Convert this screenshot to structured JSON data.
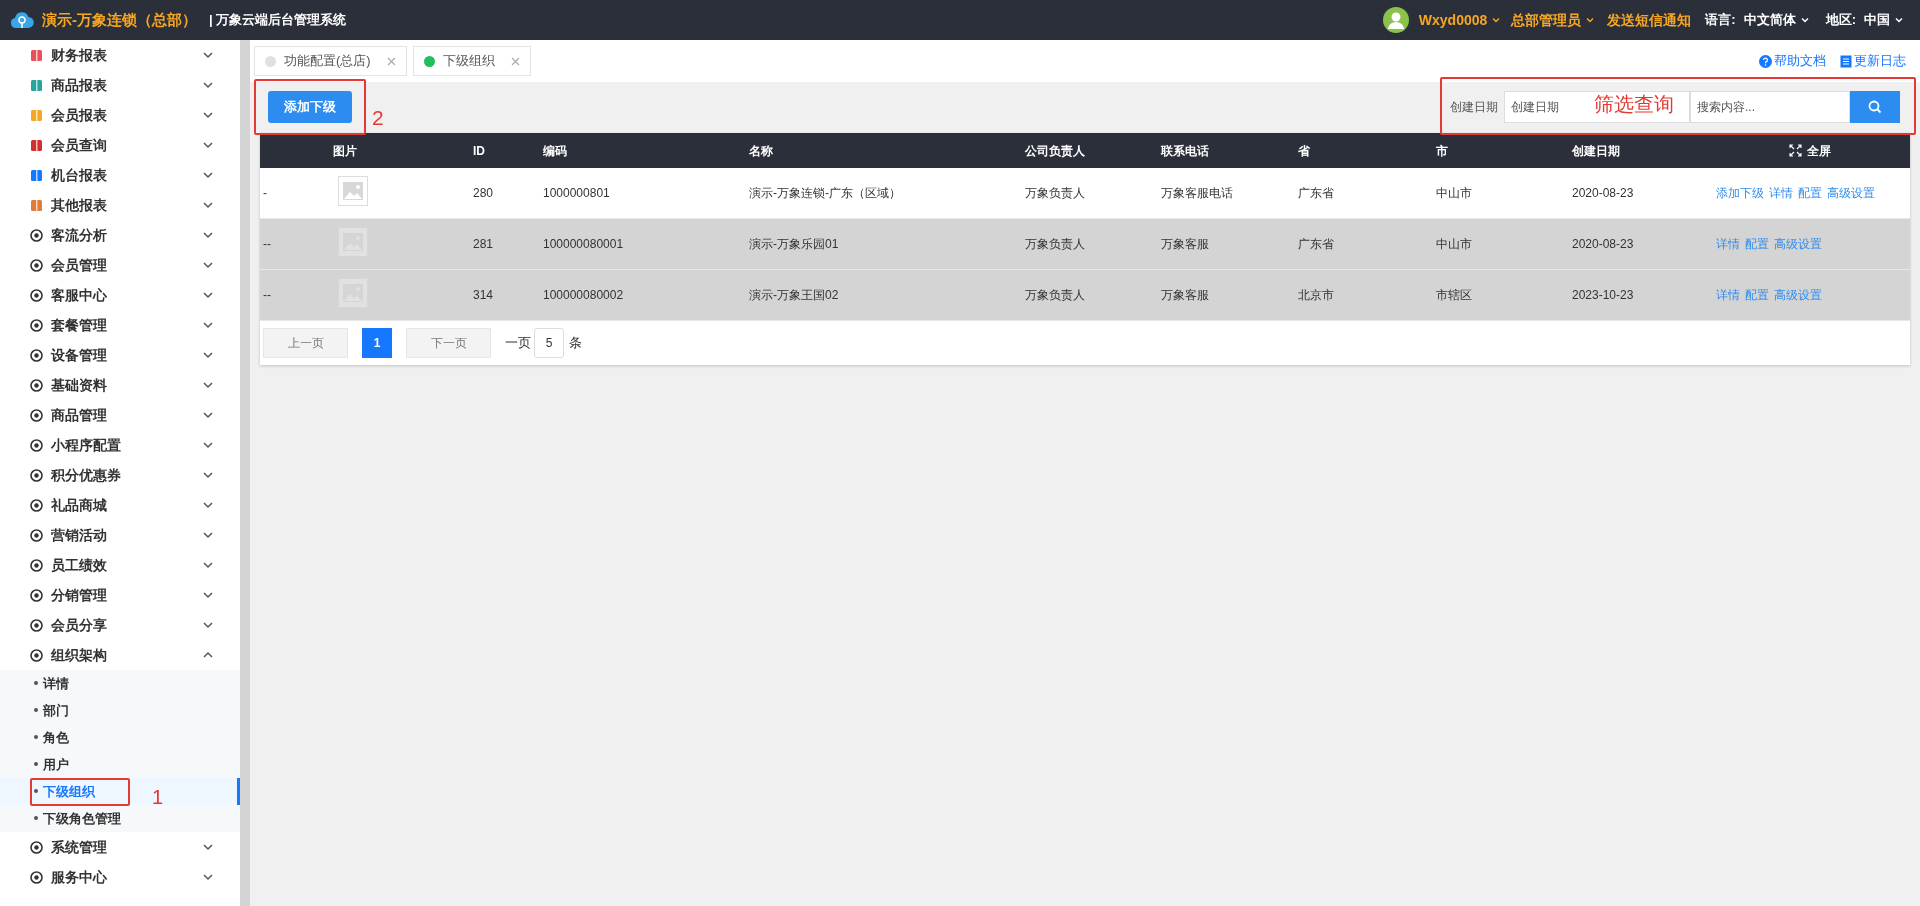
{
  "header": {
    "brand": "演示-万象连锁（总部）",
    "system": "| 万象云端后台管理系统",
    "user": "Wxyd0008",
    "role": "总部管理员",
    "sms": "发送短信通知",
    "language_label": "语言:",
    "language": "中文简体",
    "region_label": "地区:",
    "region": "中国"
  },
  "sidebar": {
    "items": [
      {
        "label": "财务报表",
        "expanded": false
      },
      {
        "label": "商品报表",
        "expanded": false
      },
      {
        "label": "会员报表",
        "expanded": false
      },
      {
        "label": "会员查询",
        "expanded": false
      },
      {
        "label": "机台报表",
        "expanded": false
      },
      {
        "label": "其他报表",
        "expanded": false
      },
      {
        "label": "客流分析",
        "expanded": false
      },
      {
        "label": "会员管理",
        "expanded": false
      },
      {
        "label": "客服中心",
        "expanded": false
      },
      {
        "label": "套餐管理",
        "expanded": false
      },
      {
        "label": "设备管理",
        "expanded": false
      },
      {
        "label": "基础资料",
        "expanded": false
      },
      {
        "label": "商品管理",
        "expanded": false
      },
      {
        "label": "小程序配置",
        "expanded": false
      },
      {
        "label": "积分优惠券",
        "expanded": false
      },
      {
        "label": "礼品商城",
        "expanded": false
      },
      {
        "label": "营销活动",
        "expanded": false
      },
      {
        "label": "员工绩效",
        "expanded": false
      },
      {
        "label": "分销管理",
        "expanded": false
      },
      {
        "label": "会员分享",
        "expanded": false
      },
      {
        "label": "组织架构",
        "expanded": true,
        "children": [
          {
            "label": "详情",
            "selected": false
          },
          {
            "label": "部门",
            "selected": false
          },
          {
            "label": "角色",
            "selected": false
          },
          {
            "label": "用户",
            "selected": false
          },
          {
            "label": "下级组织",
            "selected": true,
            "annotation": "1"
          },
          {
            "label": "下级角色管理",
            "selected": false
          }
        ]
      },
      {
        "label": "系统管理",
        "expanded": false
      },
      {
        "label": "服务中心",
        "expanded": false
      }
    ]
  },
  "tabs": [
    {
      "label": "功能配置(总店)",
      "selected": false
    },
    {
      "label": "下级组织",
      "selected": true
    }
  ],
  "help_links": [
    "帮助文档",
    "更新日志"
  ],
  "toolbar": {
    "add_button": "添加下级",
    "add_annotation": "2",
    "filter_label": "创建日期",
    "date_placeholder": "创建日期",
    "search_placeholder": "搜索内容...",
    "filter_annotation": "筛选查询"
  },
  "table": {
    "columns": [
      "",
      "图片",
      "ID",
      "编码",
      "名称",
      "公司负责人",
      "联系电话",
      "省",
      "市",
      "创建日期"
    ],
    "fullscreen": "全屏",
    "rows": [
      {
        "selected": false,
        "cells": [
          "-",
          "",
          "280",
          "1000000801",
          "演示-万象连锁-广东（区域）",
          "万象负责人",
          "万象客服电话",
          "广东省",
          "中山市",
          "2020-08-23"
        ],
        "actions": [
          "添加下级",
          "详情",
          "配置",
          "高级设置"
        ]
      },
      {
        "selected": true,
        "cells": [
          "--",
          "",
          "281",
          "100000080001",
          "演示-万象乐园01",
          "万象负责人",
          "万象客服",
          "广东省",
          "中山市",
          "2020-08-23"
        ],
        "actions": [
          "详情",
          "配置",
          "高级设置"
        ]
      },
      {
        "selected": true,
        "cells": [
          "--",
          "",
          "314",
          "100000080002",
          "演示-万象王国02",
          "万象负责人",
          "万象客服",
          "北京市",
          "市辖区",
          "2023-10-23"
        ],
        "actions": [
          "详情",
          "配置",
          "高级设置"
        ]
      }
    ]
  },
  "pagination": {
    "prev": "上一页",
    "pages": [
      {
        "label": "1",
        "selected": true
      }
    ],
    "next": "下一页",
    "per_page_label": "一页",
    "per_page": "5",
    "unit": "条"
  }
}
